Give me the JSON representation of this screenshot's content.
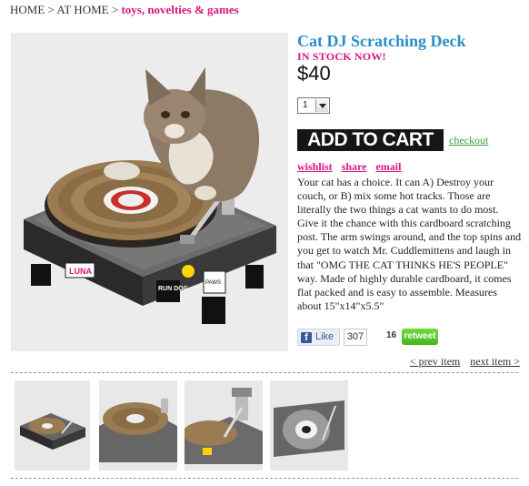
{
  "breadcrumb": {
    "home": "HOME",
    "sep1": " > ",
    "at_home": "AT HOME",
    "sep2": " > ",
    "category": "toys, novelties & games"
  },
  "product": {
    "title": "Cat DJ Scratching Deck",
    "stock": "IN STOCK NOW!",
    "price": "$40",
    "quantity": "1",
    "add_to_cart": "ADD TO CART",
    "checkout": "checkout",
    "description": "Your cat has a choice. It can A) Destroy your couch, or B) mix some hot tracks. Those are literally the two things a cat wants to do most. Give it the chance with this cardboard scratching post. The arm swings around, and the top spins and you get to watch Mr. Cuddlemittens and laugh in that \"OMG THE CAT THINKS HE'S PEOPLE\" way. Made of highly durable cardboard, it comes flat packed and is easy to assemble. Measures about 15\"x14\"x5.5\""
  },
  "share": {
    "wishlist": "wishlist",
    "share": "share",
    "email": "email"
  },
  "social": {
    "like_label": "Like",
    "like_count": "307",
    "retweet_count": "16",
    "retweet_label": "retweet"
  },
  "pager": {
    "prev": "< prev item",
    "next": "next item >"
  },
  "images": {
    "turntable_labels": {
      "luna": "LUNA",
      "run_dmc": "RUN DOG",
      "paws": "PAWS"
    },
    "thumbnails": [
      "thumbnail-front",
      "thumbnail-platter",
      "thumbnail-arm",
      "thumbnail-top"
    ]
  },
  "colors": {
    "title": "#2c8ec8",
    "accent_pink": "#d6157f",
    "checkout_green": "#3aa03a",
    "cart_button": "#161616",
    "retweet_green": "#43b51e",
    "facebook_blue": "#3b5998"
  }
}
